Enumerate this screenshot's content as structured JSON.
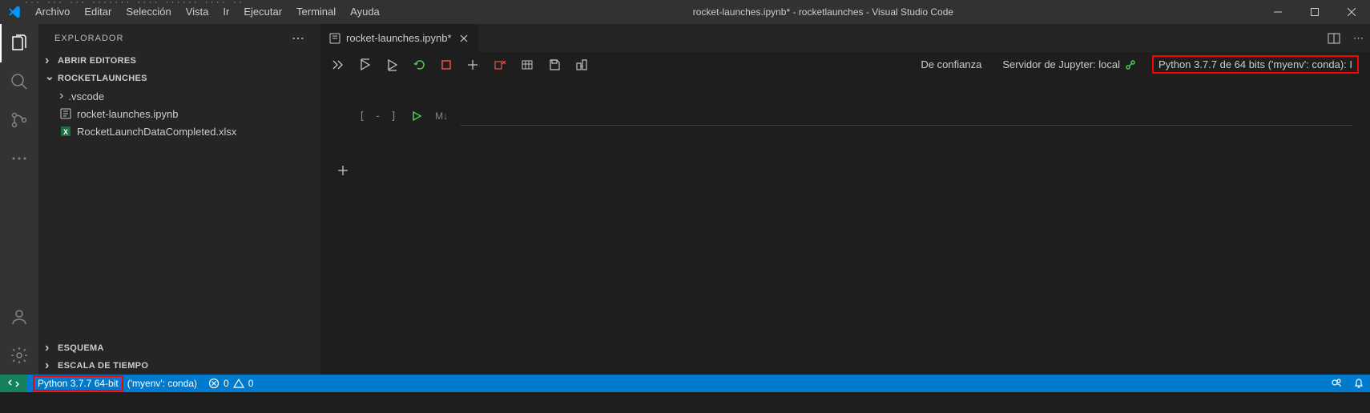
{
  "menu": {
    "file": "Archivo",
    "edit": "Editar",
    "selection": "Selección",
    "view": "Vista",
    "go": "Ir",
    "run": "Ejecutar",
    "terminal": "Terminal",
    "help": "Ayuda"
  },
  "window_title": "rocket-launches.ipynb* - rocketlaunches - Visual Studio Code",
  "sidebar": {
    "title": "EXPLORADOR",
    "sections": {
      "open_editors": "ABRIR EDITORES",
      "folder": "ROCKETLAUNCHES",
      "outline": "ESQUEMA",
      "timeline": "ESCALA DE TIEMPO"
    },
    "tree": {
      "vscode_folder": ".vscode",
      "notebook": "rocket-launches.ipynb",
      "xlsx": "RocketLaunchDataCompleted.xlsx"
    }
  },
  "tab": {
    "label": "rocket-launches.ipynb*"
  },
  "notebook": {
    "trusted": "De confianza",
    "server": "Servidor de Jupyter: local",
    "kernel": "Python 3.7.7 de 64 bits ('myenv': conda): I",
    "cell_bracket": "[ - ]",
    "markdown_label": "M↓"
  },
  "status": {
    "python": "Python 3.7.7 64-bit",
    "env": "('myenv': conda)",
    "errors": "0",
    "warnings": "0"
  }
}
